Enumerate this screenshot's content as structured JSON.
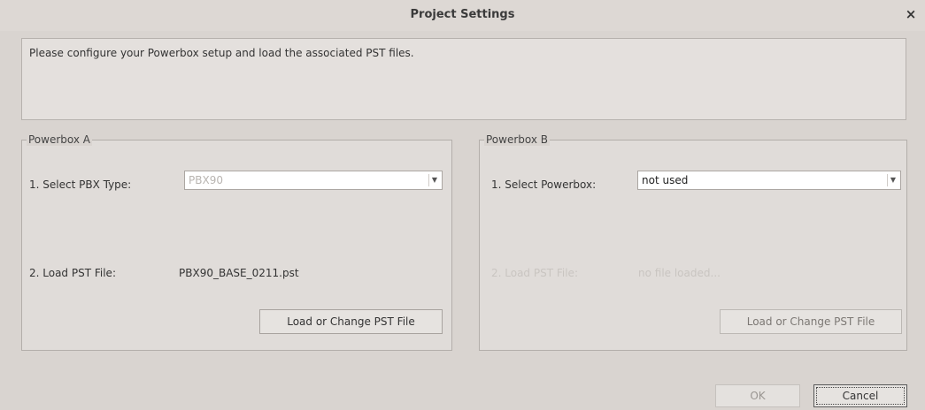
{
  "window": {
    "title": "Project Settings",
    "close_glyph": "×"
  },
  "info": {
    "text": "Please configure your Powerbox setup and load the associated PST files."
  },
  "powerbox_a": {
    "legend": "Powerbox A",
    "select_label": "1. Select PBX Type:",
    "select_value": "PBX90",
    "load_label": "2. Load PST File:",
    "file_name": "PBX90_BASE_0211.pst",
    "load_button": "Load or Change PST File"
  },
  "powerbox_b": {
    "legend": "Powerbox B",
    "select_label": "1. Select Powerbox:",
    "select_value": "not used",
    "load_label": "2. Load PST File:",
    "file_name": "no file loaded...",
    "load_button": "Load or Change PST File"
  },
  "footer": {
    "ok_label": "OK",
    "cancel_label": "Cancel"
  },
  "icons": {
    "close": "close-icon",
    "dropdown": "chevron-down-icon"
  },
  "colors": {
    "background": "#d9d4d0",
    "panel": "#e0dcd9",
    "disabled_text": "#c9c5c1"
  }
}
